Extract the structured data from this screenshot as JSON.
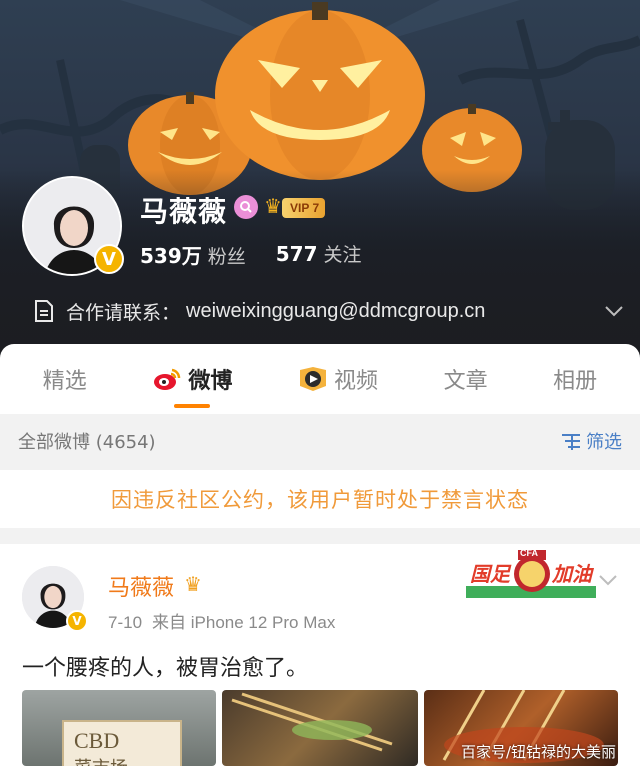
{
  "profile": {
    "name": "马薇薇",
    "verify_mark": "V",
    "vip_label": "VIP 7",
    "followers_count": "539万",
    "followers_label": "粉丝",
    "following_count": "577",
    "following_label": "关注",
    "contact_label": "合作请联系：",
    "contact_email": "weiweixingguang@ddmcgroup.cn"
  },
  "tabs": [
    {
      "label": "精选",
      "active": false
    },
    {
      "label": "微博",
      "active": true
    },
    {
      "label": "视频",
      "active": false
    },
    {
      "label": "文章",
      "active": false
    },
    {
      "label": "相册",
      "active": false
    }
  ],
  "filter": {
    "all_label": "全部微博 (4654)",
    "filter_label": "筛选"
  },
  "notice": "因违反社区公约，该用户暂时处于禁言状态",
  "post": {
    "author": "马薇薇",
    "date": "7-10",
    "source": "来自 iPhone 12 Pro Max",
    "text": "一个腰疼的人，被胃治愈了。",
    "sticker_text_left": "国足",
    "sticker_text_right": "加油",
    "sticker_badge": "CFA",
    "photo_sign": "CBD",
    "photo_sign_sub": "菜市场",
    "watermark": "百家号/钮钴禄的大美丽"
  },
  "colors": {
    "accent_orange": "#ff8200",
    "notice_orange": "#f09a3a",
    "link_blue": "#4a7fc6",
    "verify_gold": "#f5b400"
  }
}
